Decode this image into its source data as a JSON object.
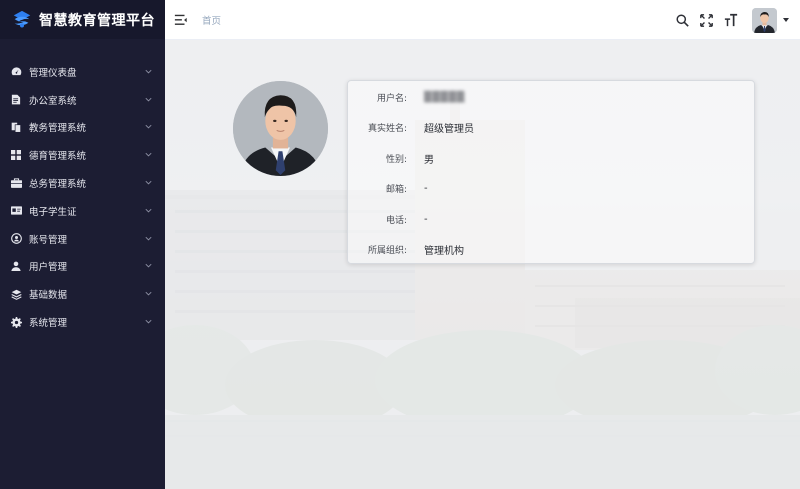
{
  "app": {
    "title": "智慧教育管理平台"
  },
  "sidebar": {
    "items": [
      {
        "label": "管理仪表盘",
        "icon": "dashboard-icon"
      },
      {
        "label": "办公室系统",
        "icon": "document-icon"
      },
      {
        "label": "教务管理系统",
        "icon": "copy-icon"
      },
      {
        "label": "德育管理系统",
        "icon": "grid-icon"
      },
      {
        "label": "总务管理系统",
        "icon": "briefcase-icon"
      },
      {
        "label": "电子学生证",
        "icon": "id-card-icon"
      },
      {
        "label": "账号管理",
        "icon": "account-circle-icon"
      },
      {
        "label": "用户管理",
        "icon": "user-icon"
      },
      {
        "label": "基础数据",
        "icon": "layers-icon"
      },
      {
        "label": "系统管理",
        "icon": "gear-icon"
      }
    ]
  },
  "header": {
    "breadcrumb": "首页",
    "tools": [
      "search-icon",
      "fullscreen-icon",
      "font-size-icon"
    ]
  },
  "profile": {
    "fields": [
      {
        "label": "用户名:",
        "value": "▒▒▒▒▒",
        "obscured": true
      },
      {
        "label": "真实姓名:",
        "value": "超级管理员"
      },
      {
        "label": "性别:",
        "value": "男"
      },
      {
        "label": "邮箱:",
        "value": "-"
      },
      {
        "label": "电话:",
        "value": "-"
      },
      {
        "label": "所属组织:",
        "value": "管理机构"
      }
    ]
  },
  "colors": {
    "sidebar_bg": "#1c1d33",
    "logo_bg": "#17182c",
    "logo_blue": "#2e7ff0",
    "header_bg": "#ffffff",
    "breadcrumb": "#97a8be"
  }
}
